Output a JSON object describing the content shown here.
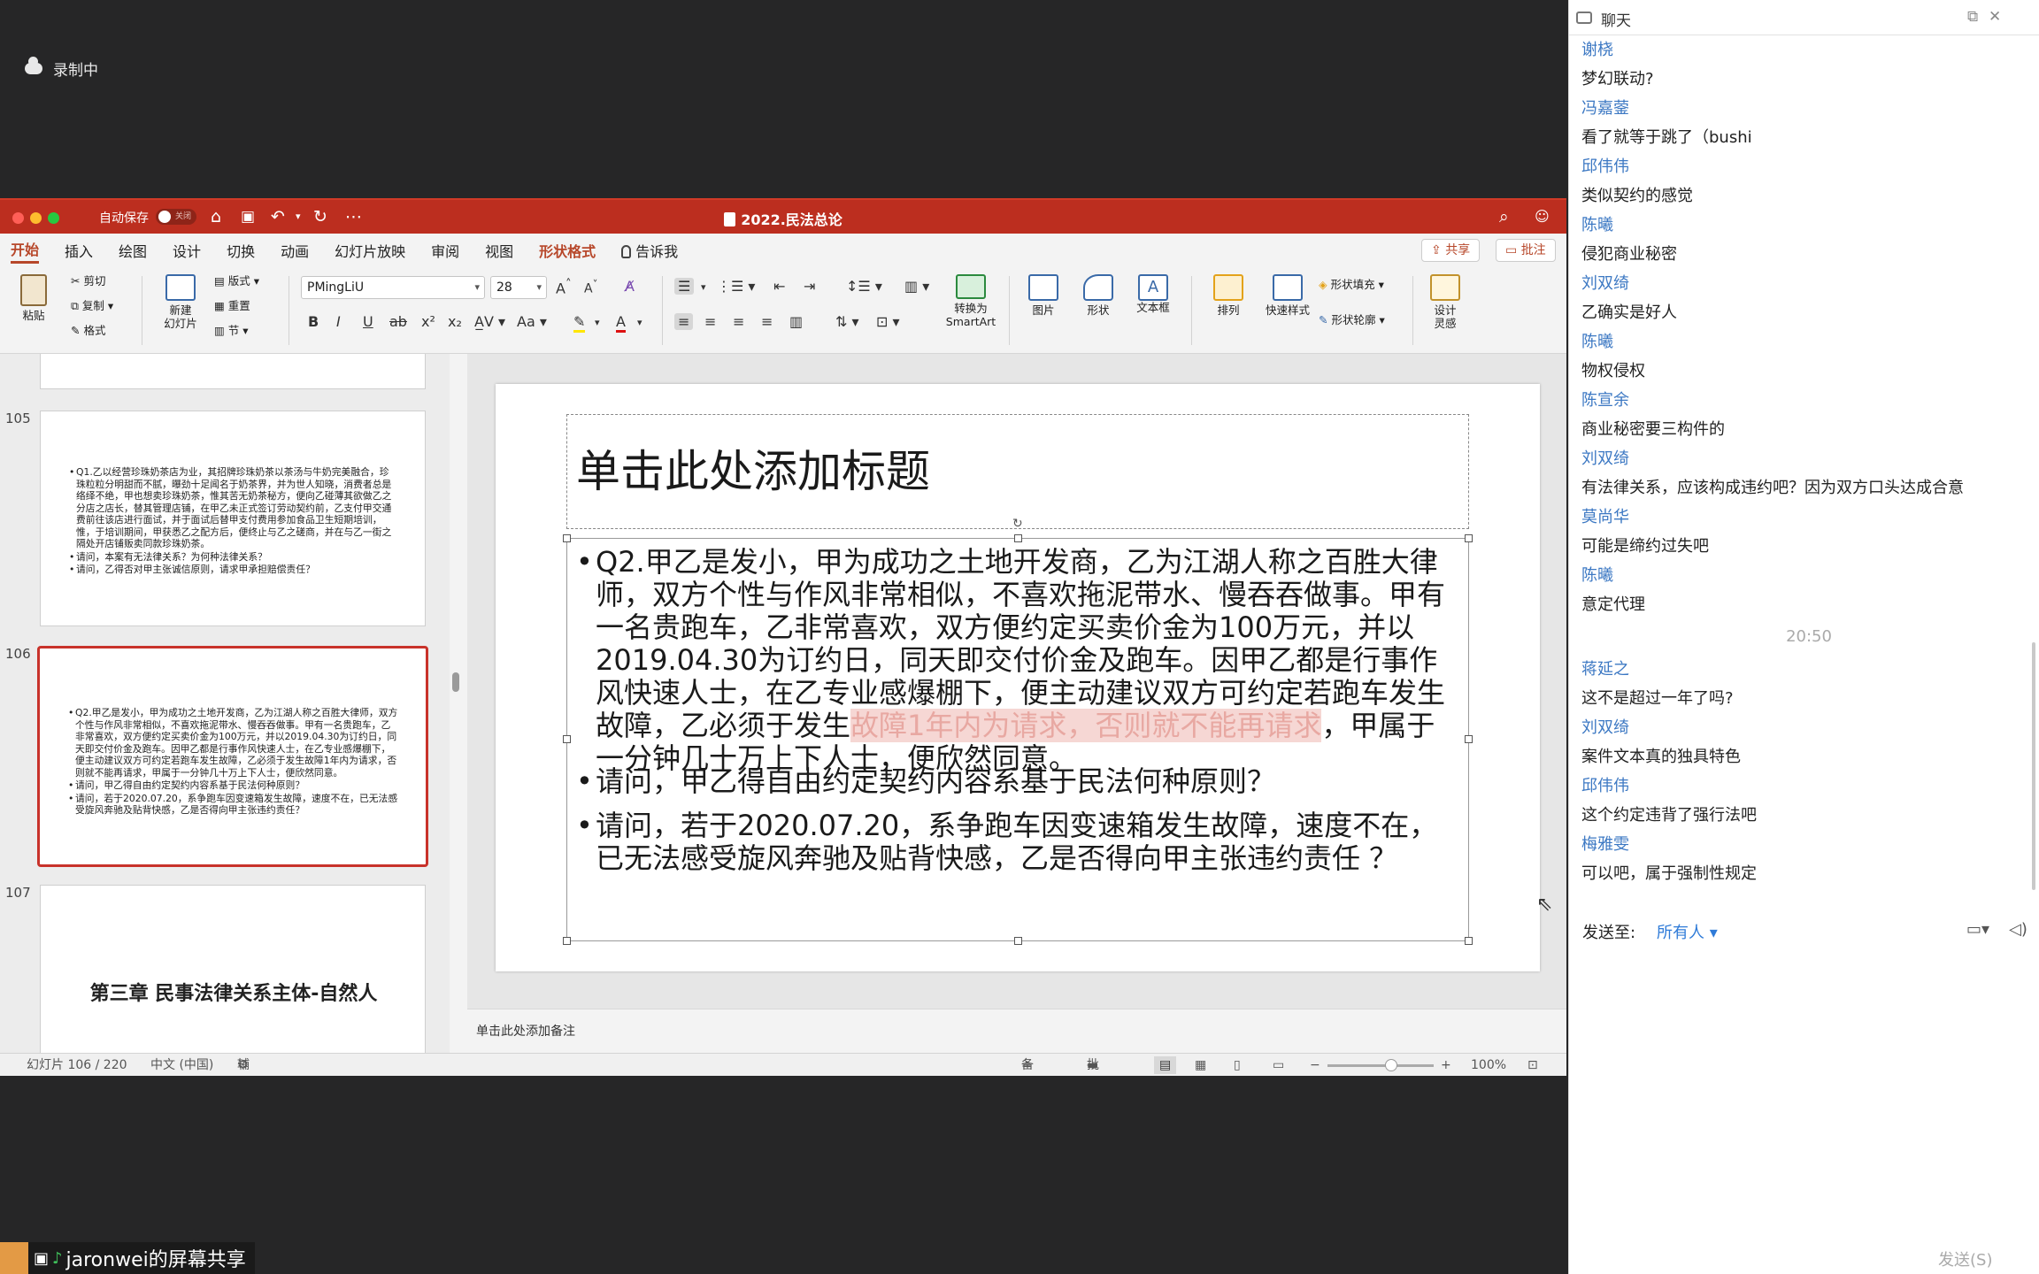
{
  "recording": {
    "label": "录制中"
  },
  "app": {
    "autosave_label": "自动保存",
    "autosave_state": "关闭",
    "doc_title": "2022.民法总论"
  },
  "menu": {
    "tabs": [
      "开始",
      "插入",
      "绘图",
      "设计",
      "切换",
      "动画",
      "幻灯片放映",
      "审阅",
      "视图",
      "形状格式"
    ],
    "tell_me": "告诉我",
    "share": "共享",
    "comments": "批注"
  },
  "ribbon": {
    "paste": "粘贴",
    "cut": "剪切",
    "copy": "复制",
    "format": "格式",
    "new_slide": "新建\n幻灯片",
    "layout": "版式",
    "reset": "重置",
    "section": "节",
    "font_name": "PMingLiU",
    "font_size": "28",
    "convert_smartart": "转换为\nSmartArt",
    "picture": "图片",
    "shape": "形状",
    "textbox": "文本框",
    "arrange": "排列",
    "quick_styles": "快速样式",
    "shape_fill": "形状填充",
    "shape_outline": "形状轮廓",
    "designer": "设计\n灵感"
  },
  "thumbs": {
    "n105": "105",
    "n106": "106",
    "n107": "107",
    "t105_p1": "Q1.乙以经营珍珠奶茶店为业，其招牌珍珠奶茶以茶汤与牛奶完美融合，珍珠粒粒分明甜而不腻，曝劲十足闻名于奶茶界，并为世人知晓，消费者总是络绎不绝，甲也想卖珍珠奶茶，惟其苦无奶茶秘方，便向乙碰薄其欲做乙之分店之店长，替其管理店铺，在甲乙未正式签订劳动契约前，乙支付甲交通费前往该店进行面试，并于面试后替甲支付费用参加食品卫生短期培训，惟，于培训期间，甲获悉乙之配方后，便终止与乙之磋商，并在与乙一街之隔处开店铺贩卖同款珍珠奶茶。",
    "t105_p2": "请问，本案有无法律关系？为何种法律关系？",
    "t105_p3": "请问，乙得否对甲主张诚信原则，请求甲承担赔偿责任？",
    "t106_p1": "Q2.甲乙是发小，甲为成功之土地开发商，乙为江湖人称之百胜大律师，双方个性与作风非常相似，不喜欢拖泥带水、慢吞吞做事。甲有一名贵跑车，乙非常喜欢，双方便约定买卖价金为100万元，并以2019.04.30为订约日，同天即交付价金及跑车。因甲乙都是行事作风快速人士，在乙专业感爆棚下，便主动建议双方可约定若跑车发生故障，乙必须于发生故障1年内为请求，否则就不能再请求，甲属于一分钟几十万上下人士，便欣然同意。",
    "t106_p2": "请问，甲乙得自由约定契约内容系基于民法何种原则？",
    "t106_p3": "请问，若于2020.07.20，系争跑车因变速箱发生故障，速度不在，已无法感受旋风奔驰及贴背快感，乙是否得向甲主张违约责任？",
    "t107_title": "第三章 民事法律关系主体-自然人"
  },
  "slide": {
    "title": "单击此处添加标题",
    "p1_a": "Q2.甲乙是发小，甲为成功之土地开发商，乙为江湖人称之百胜大律师，双方个性与作风非常相似，不喜欢拖泥带水、慢吞吞做事。甲有一名贵跑车，乙非常喜欢，双方便约定买卖价金为100万元，并以2019.04.30为订约日，同天即交付价金及跑车。因甲乙都是行事作风快速人士，在乙专业感爆棚下，便主动建议双方可约定若跑车发生故障，乙必须于发生",
    "p1_hl": "故障1年内为请求，否则就不能再请求",
    "p1_b": "，甲属于一分钟几十万上下人士，便欣然同意。",
    "p2": "请问，甲乙得自由约定契约内容系基于民法何种原则？",
    "p3": "请问，若于2020.07.20，系争跑车因变速箱发生故障，速度不在，已无法感受旋风奔驰及贴背快感，乙是否得向甲主张违约责任 ？"
  },
  "notes": {
    "placeholder": "单击此处添加备注"
  },
  "status": {
    "slide_count": "幻灯片 106 / 220",
    "language": "中文 (中国)",
    "accessibility": "辅助功能: 调查",
    "notes": "备注",
    "comments": "批注",
    "zoom": "100%",
    "zoom_fraction": 0.6
  },
  "chat": {
    "title": "聊天",
    "messages": [
      {
        "name": "谢桡",
        "text": "梦幻联动?"
      },
      {
        "name": "冯嘉蓥",
        "text": "看了就等于跳了（bushi"
      },
      {
        "name": "邱伟伟",
        "text": "类似契约的感觉"
      },
      {
        "name": "陈曦",
        "text": "侵犯商业秘密"
      },
      {
        "name": "刘双绮",
        "text": "乙确实是好人"
      },
      {
        "name": "陈曦",
        "text": "物权侵权"
      },
      {
        "name": "陈宣余",
        "text": "商业秘密要三构件的"
      },
      {
        "name": "刘双绮",
        "text": "有法律关系，应该构成违约吧？因为双方口头达成合意"
      },
      {
        "name": "莫尚华",
        "text": "可能是缔约过失吧"
      },
      {
        "name": "陈曦",
        "text": "意定代理"
      }
    ],
    "time": "20:50",
    "messages2": [
      {
        "name": "蒋延之",
        "text": "这不是超过一年了吗?"
      },
      {
        "name": "刘双绮",
        "text": "案件文本真的独具特色"
      },
      {
        "name": "邱伟伟",
        "text": "这个约定违背了强行法吧"
      },
      {
        "name": "梅雅雯",
        "text": "可以吧，属于强制性规定"
      }
    ],
    "send_to_label": "发送至:",
    "send_to_target": "所有人",
    "send_button": "发送(S)"
  },
  "share_bar": {
    "label": "jaronwei的屏幕共享"
  },
  "colors": {
    "title_bar": "#bc2e1f",
    "accent": "#b7472a",
    "chat_name": "#3c78c3",
    "highlight": "#f6d7d4"
  }
}
